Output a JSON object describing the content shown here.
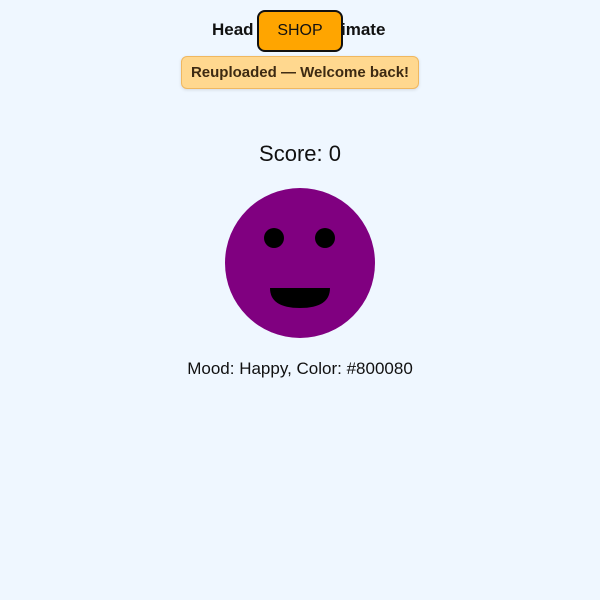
{
  "header": {
    "title_left": "Head",
    "title_right": "imate",
    "shop_label": "SHOP"
  },
  "toast": {
    "message": "Reuploaded — Welcome back!"
  },
  "game": {
    "score_label": "Score",
    "score_value": "0",
    "mood": "Happy",
    "face_color": "#800080"
  },
  "colors": {
    "background": "#eff7ff",
    "shop_button": "#ffa500",
    "toast_background": "#ffd88f",
    "face": "#800080",
    "features": "#000000"
  },
  "icons": {
    "face": "smiley-face-icon"
  }
}
